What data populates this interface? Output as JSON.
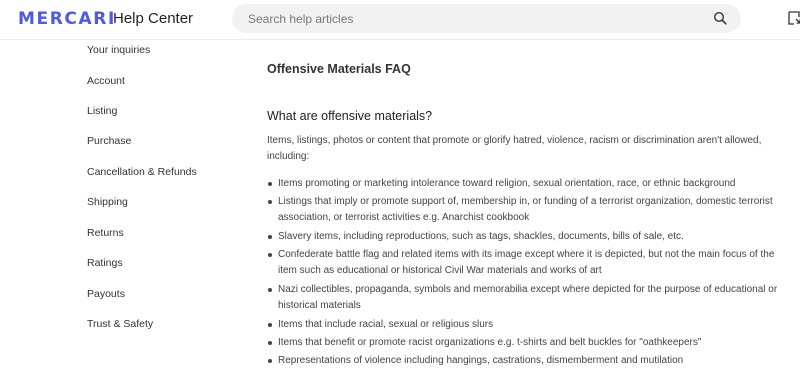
{
  "header": {
    "logo": "MERCARI",
    "logo_sub": "Help Center",
    "search_placeholder": "Search help articles",
    "search_icon": "search-icon",
    "help_icon": "external-help-icon"
  },
  "sidebar": {
    "items": [
      {
        "label": "Your inquiries"
      },
      {
        "label": "Account"
      },
      {
        "label": "Listing"
      },
      {
        "label": "Purchase"
      },
      {
        "label": "Cancellation & Refunds"
      },
      {
        "label": "Shipping"
      },
      {
        "label": "Returns"
      },
      {
        "label": "Ratings"
      },
      {
        "label": "Payouts"
      },
      {
        "label": "Trust & Safety"
      }
    ]
  },
  "article": {
    "title": "Offensive Materials FAQ",
    "question": "What are offensive materials?",
    "intro": "Items, listings, photos or content that promote or glorify hatred, violence, racism or discrimination aren't allowed, including:",
    "bullets": [
      "Items promoting or marketing intolerance toward religion, sexual orientation, race, or ethnic background",
      "Listings that imply or promote support of, membership in, or funding of a terrorist organization, domestic terrorist association, or terrorist activities e.g. Anarchist cookbook",
      "Slavery items, including reproductions, such as tags, shackles, documents, bills of sale, etc.",
      "Confederate battle flag and related items with its image except where it is depicted, but not the main focus of the item such as educational or historical Civil War materials and works of art",
      "Nazi collectibles, propaganda, symbols and memorabilia except where depicted for the purpose of educational or historical materials",
      "Items that include racial, sexual or religious slurs",
      "Items that benefit or promote racist organizations e.g. t-shirts and belt buckles for \"oathkeepers\"",
      "Representations of violence including hangings, castrations, dismemberment and mutilation"
    ]
  },
  "colors": {
    "brand": "#4d5ae6",
    "text": "#333333",
    "search_bg": "#f2f2f2"
  }
}
